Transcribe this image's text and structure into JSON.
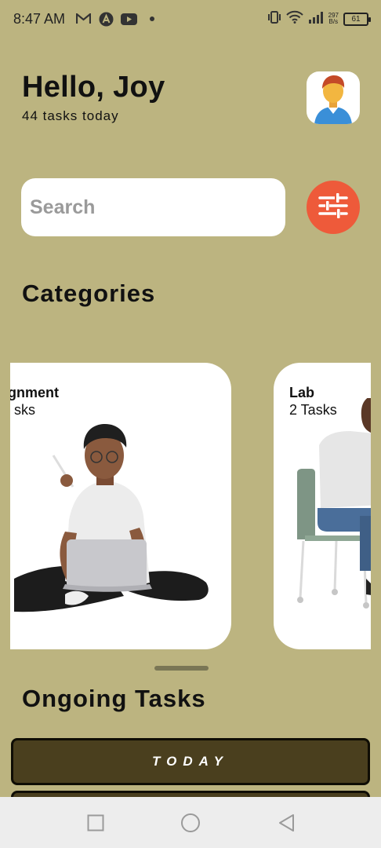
{
  "status_bar": {
    "time": "8:47 AM",
    "net_speed_value": "297",
    "net_speed_unit": "B/s",
    "battery": "61",
    "left_icons": [
      "gmail-icon",
      "arc-app-icon",
      "youtube-icon",
      "dot-icon"
    ],
    "right_icons": [
      "vibrate-icon",
      "wifi-icon",
      "signal-icon",
      "battery-icon"
    ]
  },
  "header": {
    "greeting": "Hello, Joy",
    "task_count": "44 tasks today",
    "avatar_icon": "user-avatar-icon"
  },
  "search": {
    "placeholder": "Search",
    "value": "",
    "filter_icon": "sliders-icon"
  },
  "categories": {
    "title": "Categories",
    "items": [
      {
        "title": "gnment",
        "subtitle": "sks"
      },
      {
        "title": "Lab",
        "subtitle": "2 Tasks"
      }
    ]
  },
  "ongoing": {
    "title": "Ongoing Tasks",
    "tabs": [
      {
        "label": "TODAY"
      }
    ]
  },
  "nav": {
    "icons": [
      "recents-square-icon",
      "home-circle-icon",
      "back-triangle-icon"
    ]
  },
  "colors": {
    "background": "#BCB480",
    "accent": "#EE5A3A",
    "task_button": "#4A3F1E",
    "card": "#FFFFFF"
  }
}
